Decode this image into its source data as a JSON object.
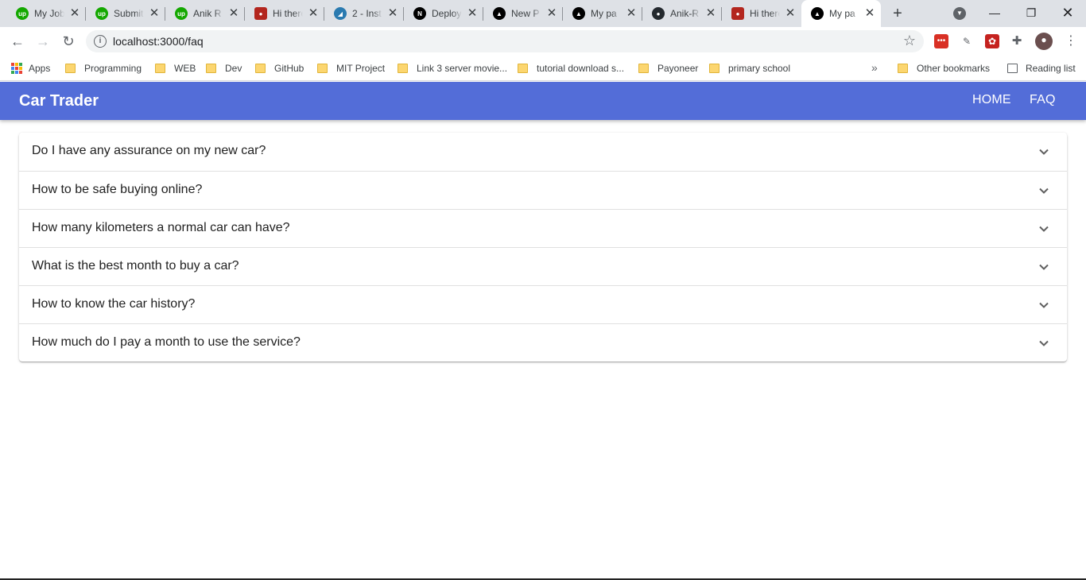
{
  "browser": {
    "tabs": [
      {
        "title": "My Jobs",
        "favicon": "upwork-icon",
        "color": "#14a800",
        "glyph": "up"
      },
      {
        "title": "Submit",
        "favicon": "upwork-icon",
        "color": "#14a800",
        "glyph": "up"
      },
      {
        "title": "Anik R",
        "favicon": "upwork-icon",
        "color": "#14a800",
        "glyph": "up"
      },
      {
        "title": "Hi there",
        "favicon": "avatar-icon",
        "color": "#b3261e",
        "glyph": "●"
      },
      {
        "title": "2 - Inst",
        "favicon": "bird-icon",
        "color": "#2a7ab0",
        "glyph": "◢"
      },
      {
        "title": "Deploy",
        "favicon": "nextjs-icon",
        "color": "#000000",
        "glyph": "N"
      },
      {
        "title": "New P",
        "favicon": "vercel-icon",
        "color": "#000000",
        "glyph": "▲"
      },
      {
        "title": "My pa",
        "favicon": "vercel-icon",
        "color": "#000000",
        "glyph": "▲"
      },
      {
        "title": "Anik-R",
        "favicon": "github-icon",
        "color": "#24292e",
        "glyph": "●"
      },
      {
        "title": "Hi there",
        "favicon": "avatar-icon",
        "color": "#b3261e",
        "glyph": "●"
      },
      {
        "title": "My pa",
        "favicon": "vercel-icon",
        "color": "#000000",
        "glyph": "▲",
        "active": true
      }
    ],
    "url": "localhost:3000/faq",
    "bookmarks": [
      {
        "label": "Apps",
        "type": "apps"
      },
      {
        "label": "Programming",
        "type": "folder"
      },
      {
        "label": "WEB",
        "type": "folder"
      },
      {
        "label": "Dev",
        "type": "folder"
      },
      {
        "label": "GitHub",
        "type": "folder"
      },
      {
        "label": "MIT Project",
        "type": "folder"
      },
      {
        "label": "Link 3 server movie...",
        "type": "folder"
      },
      {
        "label": "tutorial download s...",
        "type": "folder"
      },
      {
        "label": "Payoneer",
        "type": "folder"
      },
      {
        "label": "primary school",
        "type": "folder"
      }
    ],
    "overflow": "»",
    "other_bookmarks": "Other bookmarks",
    "reading_list": "Reading list"
  },
  "app": {
    "brand": "Car Trader",
    "nav": {
      "home": "HOME",
      "faq": "FAQ"
    },
    "accent": "#536dd8"
  },
  "faq": [
    {
      "question": "Do I have any assurance on my new car?"
    },
    {
      "question": "How to be safe buying online?"
    },
    {
      "question": "How many kilometers a normal car can have?"
    },
    {
      "question": "What is the best month to buy a car?"
    },
    {
      "question": "How to know the car history?"
    },
    {
      "question": "How much do I pay a month to use the service?"
    }
  ]
}
